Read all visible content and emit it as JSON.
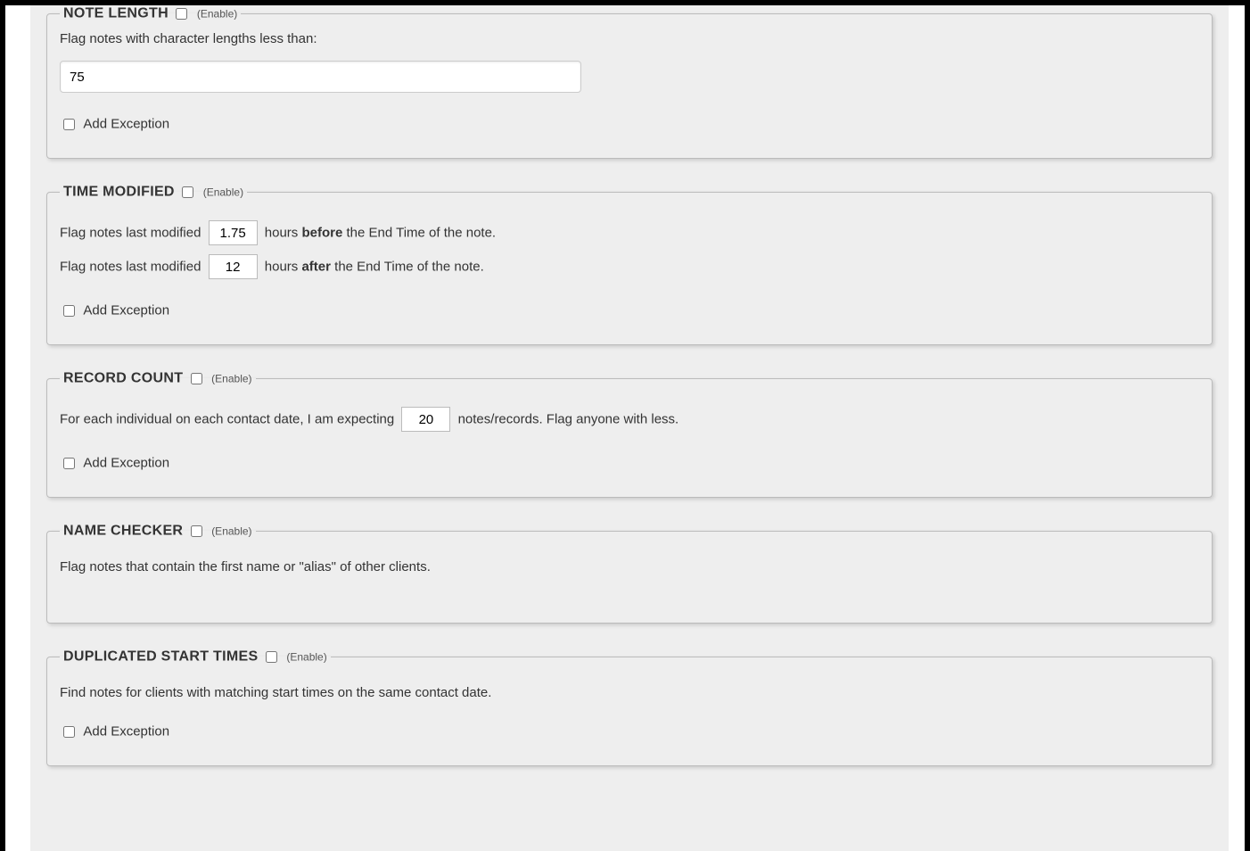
{
  "common": {
    "enable_label": "(Enable)",
    "add_exception": "Add Exception"
  },
  "note_length": {
    "title": "NOTE LENGTH",
    "desc": "Flag notes with character lengths less than:",
    "value": "75"
  },
  "time_modified": {
    "title": "TIME MODIFIED",
    "before_prefix": "Flag notes last modified",
    "before_value": "1.75",
    "before_mid": "hours",
    "before_bold": "before",
    "before_suffix": "the End Time of the note.",
    "after_prefix": "Flag notes last modified",
    "after_value": "12",
    "after_mid": "hours",
    "after_bold": "after",
    "after_suffix": "the End Time of the note."
  },
  "record_count": {
    "title": "RECORD COUNT",
    "prefix": "For each individual on each contact date, I am expecting",
    "value": "20",
    "suffix": "notes/records. Flag anyone with less."
  },
  "name_checker": {
    "title": "NAME CHECKER",
    "desc": "Flag notes that contain the first name or \"alias\" of other clients."
  },
  "dup_start": {
    "title": "DUPLICATED START TIMES",
    "desc": "Find notes for clients with matching start times on the same contact date."
  }
}
